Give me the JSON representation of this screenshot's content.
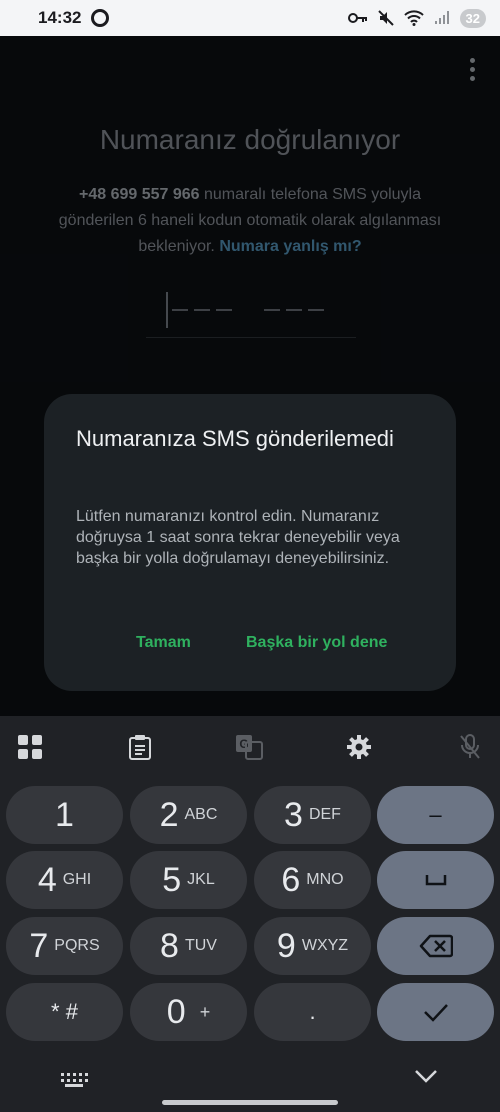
{
  "status_bar": {
    "time": "14:32",
    "battery": "32",
    "icons": [
      "key-icon",
      "mute-icon",
      "wifi-icon",
      "signal-icon"
    ]
  },
  "verification": {
    "title": "Numaranız doğrulanıyor",
    "phone": "+48 699 557 966",
    "message": "numaralı telefona SMS yoluyla gönderilen 6 haneli kodun otomatik olarak algılanması bekleniyor.",
    "wrong_number_link": "Numara yanlış mı?",
    "code_placeholder_digits": 6
  },
  "dialog": {
    "title": "Numaranıza SMS gönderilemedi",
    "body": "Lütfen numaranızı kontrol edin. Numaranız doğruysa 1 saat sonra tekrar deneyebilir veya başka bir yolla doğrulamayı deneyebilirsiniz.",
    "ok_label": "Tamam",
    "alt_label": "Başka bir yol dene"
  },
  "keyboard": {
    "toolbar": [
      "apps-grid-icon",
      "clipboard-icon",
      "translate-icon",
      "settings-gear-icon",
      "mic-off-icon"
    ],
    "keys": [
      {
        "main": "1",
        "sub": ""
      },
      {
        "main": "2",
        "sub": "ABC"
      },
      {
        "main": "3",
        "sub": "DEF"
      },
      {
        "main": "4",
        "sub": "GHI"
      },
      {
        "main": "5",
        "sub": "JKL"
      },
      {
        "main": "6",
        "sub": "MNO"
      },
      {
        "main": "7",
        "sub": "PQRS"
      },
      {
        "main": "8",
        "sub": "TUV"
      },
      {
        "main": "9",
        "sub": "WXYZ"
      },
      {
        "main": "* #",
        "sub": ""
      },
      {
        "main": "0",
        "sub": "+"
      },
      {
        "main": ".",
        "sub": ""
      }
    ],
    "function_keys": {
      "minus": "–",
      "space": "␣"
    }
  },
  "colors": {
    "accent_green": "#2fb15f",
    "link_blue": "#4c86a9",
    "dialog_bg": "#1c2125"
  }
}
